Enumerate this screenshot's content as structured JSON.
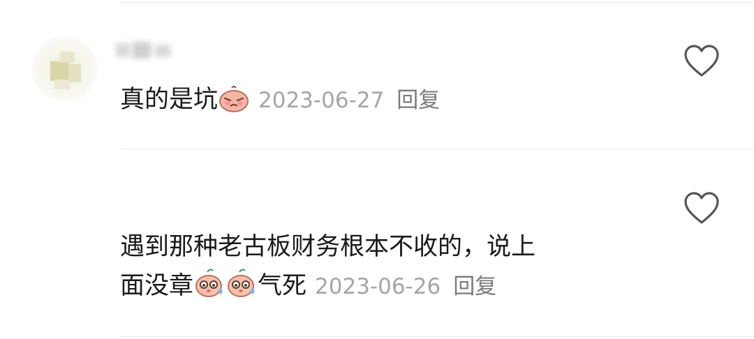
{
  "comments": [
    {
      "text": "真的是坑",
      "emojis": [
        "crying-emoji"
      ],
      "date": "2023-06-27",
      "reply_label": "回复",
      "like_icon": "heart-outline-icon",
      "avatar_blurred": true,
      "username_blurred": true
    },
    {
      "text_line1": "遇到那种老古板财务根本不收的，说上",
      "text_line2_before": "面没章",
      "emojis": [
        "sweating-emoji",
        "sweating-emoji"
      ],
      "text_line2_after": "气死",
      "date": "2023-06-26",
      "reply_label": "回复",
      "like_icon": "heart-outline-icon"
    }
  ],
  "colors": {
    "text": "#1a1a1a",
    "meta": "#a5a5a5",
    "reply": "#7a7a7a",
    "divider": "#ececec",
    "icon": "#555555"
  }
}
